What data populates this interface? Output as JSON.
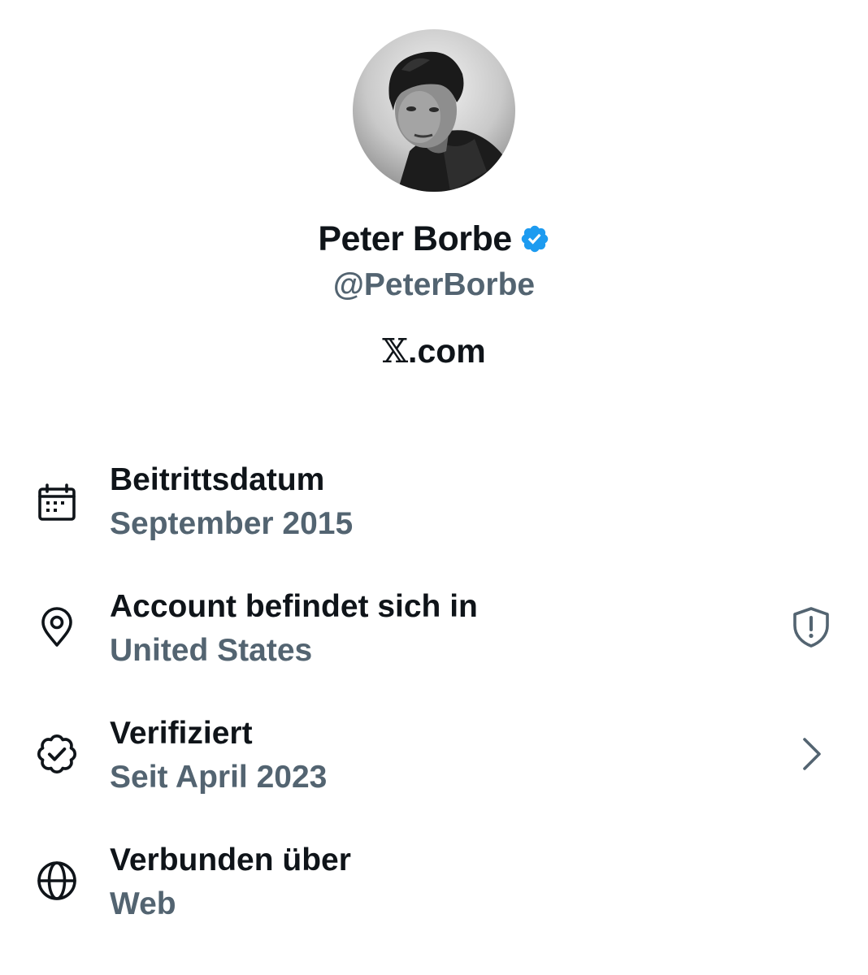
{
  "profile": {
    "display_name": "Peter Borbe",
    "handle": "@PeterBorbe",
    "verified_icon": "verified-badge-icon",
    "verified_color": "#1d9bf0",
    "source_x": "𝕏",
    "source_domain": ".com"
  },
  "details": [
    {
      "icon": "calendar-icon",
      "title": "Beitrittsdatum",
      "value": "September 2015"
    },
    {
      "icon": "location-pin-icon",
      "title": "Account befindet sich in",
      "value": "United States",
      "trailing_icon": "shield-alert-icon"
    },
    {
      "icon": "verified-check-icon",
      "title": "Verifiziert",
      "value": "Seit April 2023",
      "trailing_icon": "chevron-right-icon"
    },
    {
      "icon": "globe-icon",
      "title": "Verbunden über",
      "value": "Web"
    }
  ],
  "colors": {
    "primary_text": "#0f1419",
    "secondary_text": "#536471",
    "accent": "#1d9bf0"
  }
}
